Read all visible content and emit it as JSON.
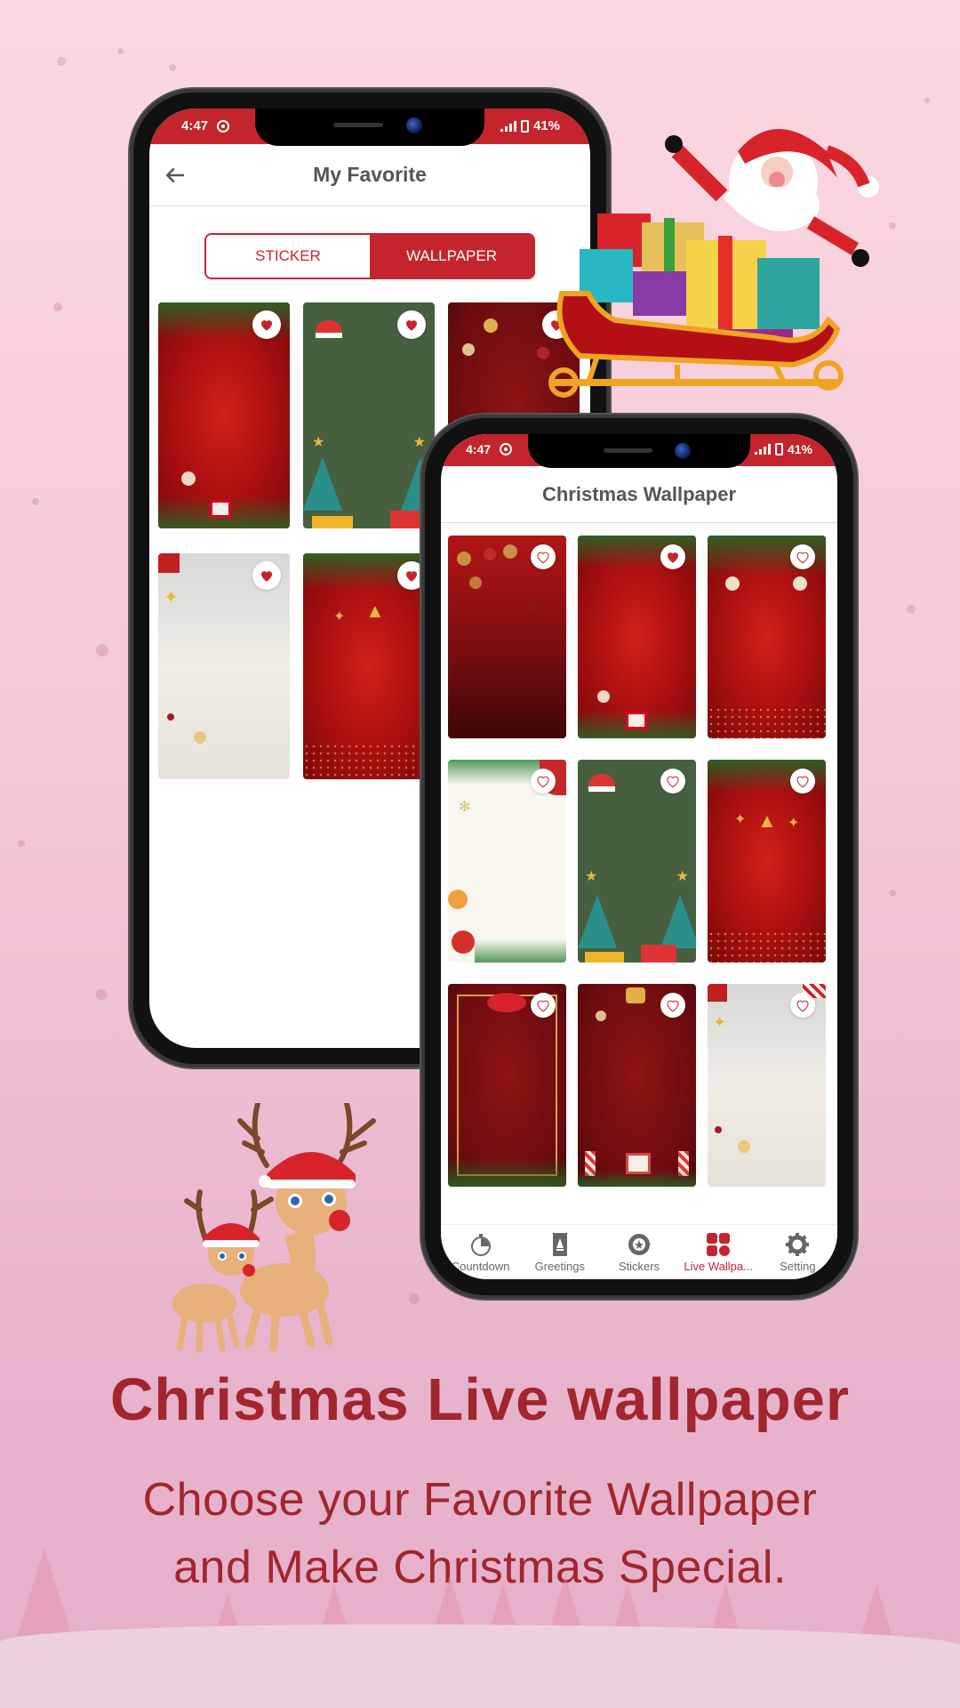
{
  "colors": {
    "brand_red": "#c4252d",
    "headline_red": "#a1262d",
    "background_pink": "#f4c8d8"
  },
  "back_phone": {
    "status_bar": {
      "time": "4:47",
      "battery": "41%"
    },
    "title": "My Favorite",
    "back_icon": "arrow-left-icon",
    "tabs": [
      {
        "label": "STICKER",
        "selected": false
      },
      {
        "label": "WALLPAPER",
        "selected": true
      }
    ],
    "wallpapers": [
      {
        "theme": "red-wreath-gifts",
        "favorited": true
      },
      {
        "theme": "green-santa-hat-trees",
        "favorited": true
      },
      {
        "theme": "red-bells-ornaments",
        "favorited": true
      },
      {
        "theme": "silver-gifts-ornaments",
        "favorited": true
      },
      {
        "theme": "red-gold-tree-stars",
        "favorited": true
      }
    ]
  },
  "front_phone": {
    "status_bar": {
      "time": "4:47",
      "battery": "41%"
    },
    "title": "Christmas Wallpaper",
    "wallpapers": [
      {
        "theme": "dark-red-hanging-ornaments",
        "favorited": false
      },
      {
        "theme": "red-wreath-gifts",
        "favorited": true
      },
      {
        "theme": "red-pine-gold-ornaments",
        "favorited": false
      },
      {
        "theme": "cream-poinsettia-holly",
        "favorited": false
      },
      {
        "theme": "green-santa-hat-trees",
        "favorited": false
      },
      {
        "theme": "red-gold-tree-stars",
        "favorited": false
      },
      {
        "theme": "red-bow-gold-frame",
        "favorited": false
      },
      {
        "theme": "maroon-candles-gift",
        "favorited": false
      },
      {
        "theme": "silver-gifts-ornaments",
        "favorited": false
      }
    ],
    "bottom_nav": [
      {
        "label": "Countdown",
        "icon": "stopwatch-icon",
        "active": false
      },
      {
        "label": "Greetings",
        "icon": "greeting-card-icon",
        "active": false
      },
      {
        "label": "Stickers",
        "icon": "sticker-icon",
        "active": false
      },
      {
        "label": "Live Wallpa...",
        "icon": "grid-icon",
        "active": true
      },
      {
        "label": "Setting",
        "icon": "gear-icon",
        "active": false
      }
    ]
  },
  "headline": "Christmas Live wallpaper",
  "subline": {
    "line1": "Choose your Favorite Wallpaper",
    "line2": "and Make Christmas Special."
  }
}
